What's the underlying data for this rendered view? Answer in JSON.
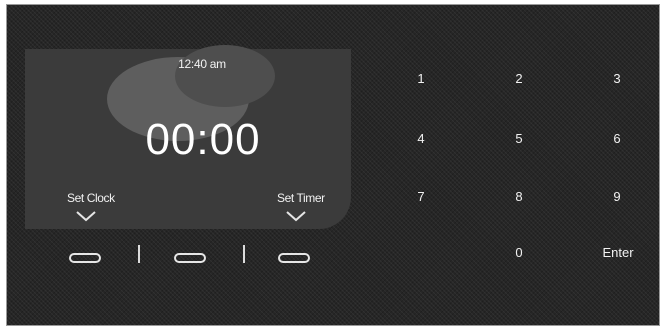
{
  "display": {
    "clock_time": "12:40 am",
    "timer_value": "00:00"
  },
  "soft_keys": {
    "set_clock_label": "Set Clock",
    "set_timer_label": "Set Timer"
  },
  "keypad": {
    "k1": "1",
    "k2": "2",
    "k3": "3",
    "k4": "4",
    "k5": "5",
    "k6": "6",
    "k7": "7",
    "k8": "8",
    "k9": "9",
    "k0": "0",
    "enter": "Enter"
  },
  "icons": {
    "set_clock_arrow": "chevron-down-icon",
    "set_timer_arrow": "chevron-down-icon"
  },
  "colors": {
    "panel": "#262626",
    "display": "#3b3b3b",
    "text": "#f2f2f2"
  }
}
